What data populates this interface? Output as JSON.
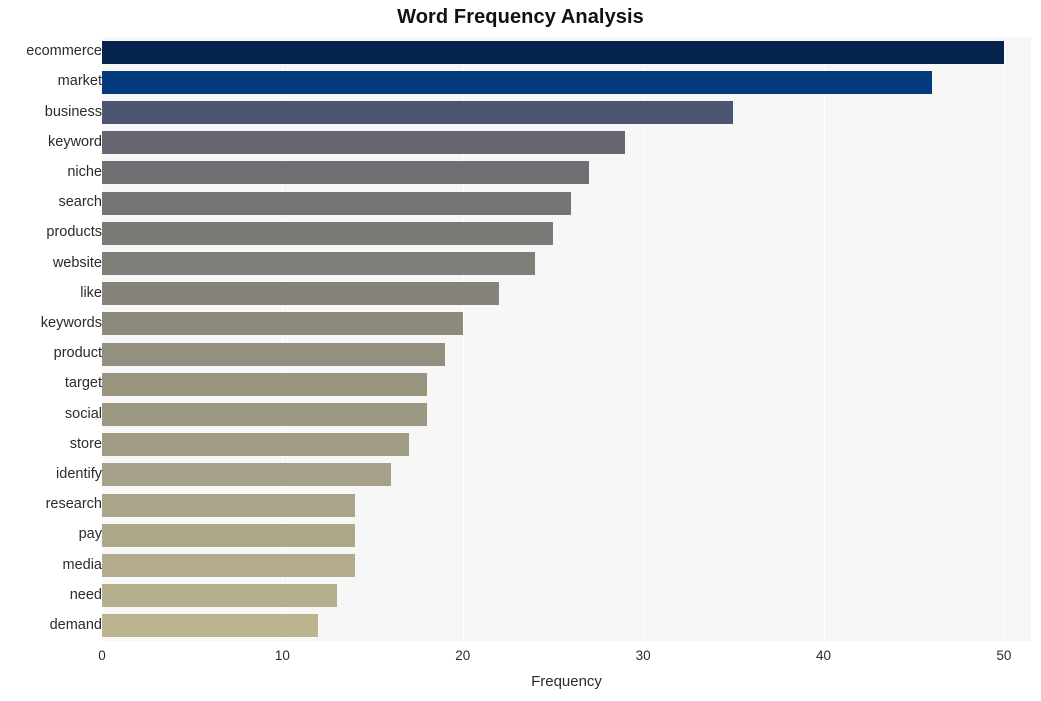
{
  "chart_data": {
    "type": "bar",
    "orientation": "horizontal",
    "title": "Word Frequency Analysis",
    "xlabel": "Frequency",
    "ylabel": "",
    "xlim": [
      0,
      51.5
    ],
    "xticks": [
      0,
      10,
      20,
      30,
      40,
      50
    ],
    "xtick_labels": [
      "0",
      "10",
      "20",
      "30",
      "40",
      "50"
    ],
    "grid": true,
    "grid_axis": "x",
    "legend": null,
    "categories": [
      "ecommerce",
      "market",
      "business",
      "keyword",
      "niche",
      "search",
      "products",
      "website",
      "like",
      "keywords",
      "product",
      "target",
      "social",
      "store",
      "identify",
      "research",
      "pay",
      "media",
      "need",
      "demand"
    ],
    "values": [
      50,
      46,
      35,
      29,
      27,
      26,
      25,
      24,
      22,
      20,
      19,
      18,
      18,
      17,
      16,
      14,
      14,
      14,
      13,
      12
    ],
    "bar_colors": [
      "#05234c",
      "#053a7c",
      "#4d5670",
      "#666770",
      "#6f7073",
      "#757575",
      "#7a7a77",
      "#7f7e78",
      "#85837a",
      "#8d8a7c",
      "#93907f",
      "#99957f",
      "#9c9882",
      "#a09c84",
      "#a5a087",
      "#aaa489",
      "#aea88a",
      "#b2ab8c",
      "#b6af8d",
      "#bbb48f"
    ],
    "plot_background": "#f7f7f7",
    "figure_background": "#ffffff",
    "gridline_color": "#ffffff",
    "text_color": "#2b2b2b",
    "title_color": "#111111"
  }
}
